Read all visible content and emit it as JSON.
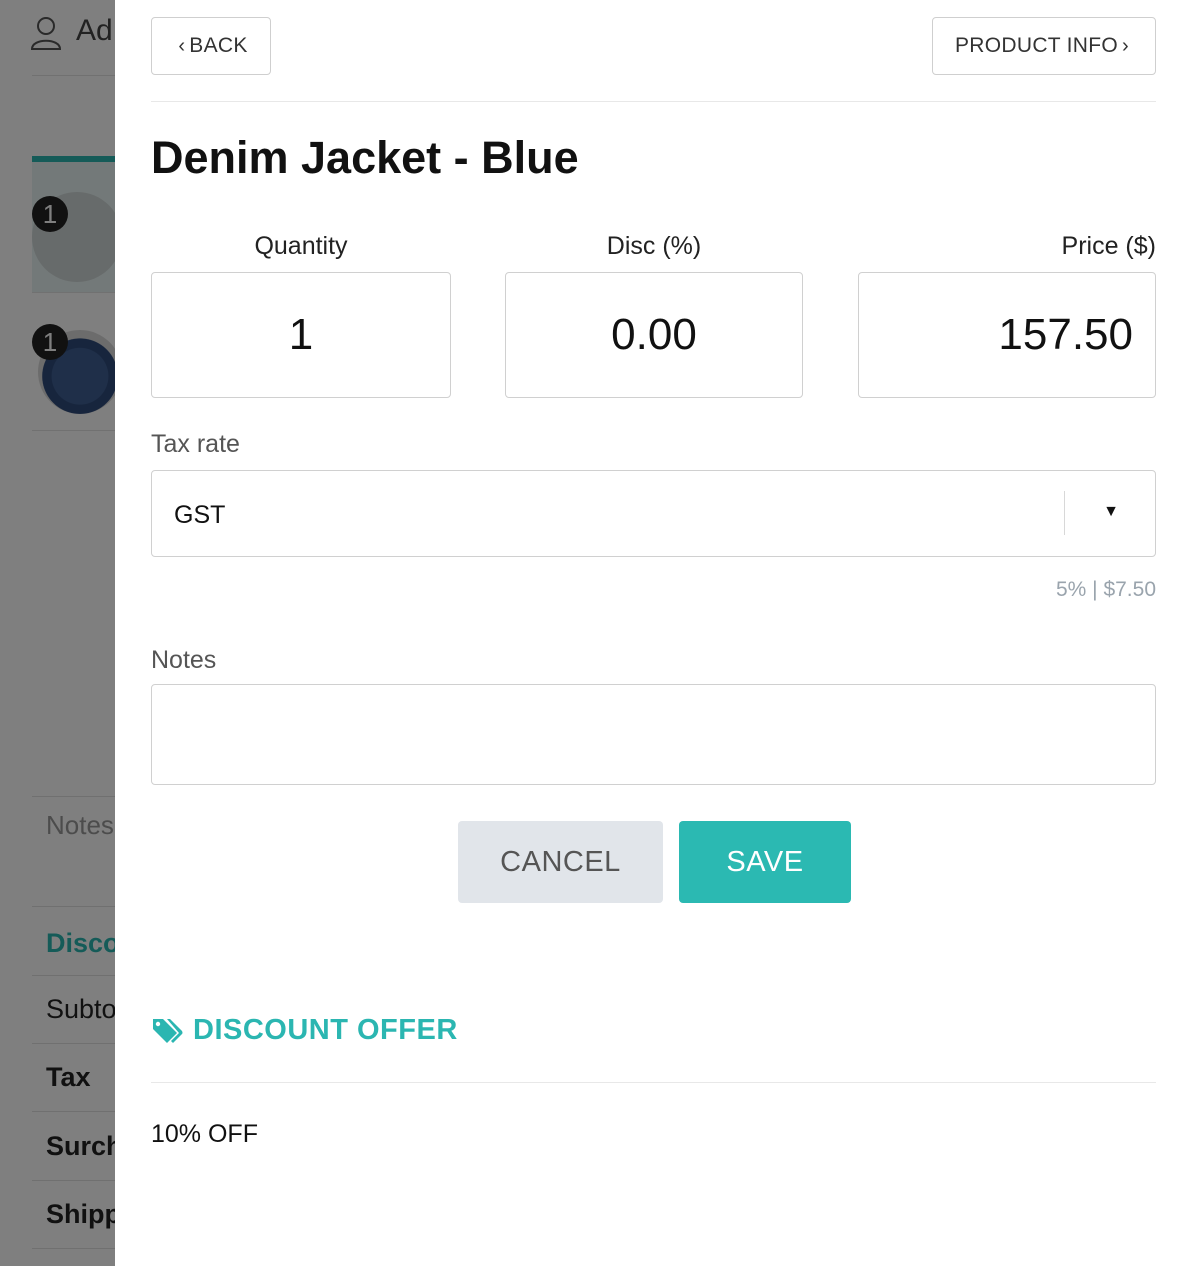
{
  "background": {
    "customer_label": "Ad",
    "items": [
      {
        "qty_badge": "1"
      },
      {
        "qty_badge": "1"
      }
    ],
    "notes_label": "Notes",
    "discount_label": "Disco",
    "subtotal_label": "Subto",
    "tax_label": "Tax",
    "surcharge_label": "Surch",
    "shipping_label": "Shipp"
  },
  "modal": {
    "back_label": "BACK",
    "product_info_label": "PRODUCT INFO",
    "title": "Denim Jacket - Blue",
    "quantity": {
      "label": "Quantity",
      "value": "1"
    },
    "discount": {
      "label": "Disc (%)",
      "value": "0.00"
    },
    "price": {
      "label": "Price ($)",
      "value": "157.50"
    },
    "tax": {
      "label": "Tax rate",
      "selected": "GST",
      "info": "5% | $7.50"
    },
    "notes": {
      "label": "Notes",
      "value": ""
    },
    "cancel_label": "CANCEL",
    "save_label": "SAVE",
    "offer": {
      "heading": "DISCOUNT OFFER",
      "text": "10% OFF"
    }
  },
  "colors": {
    "accent": "#2bb6b1",
    "cancel_bg": "#e1e5ea"
  }
}
